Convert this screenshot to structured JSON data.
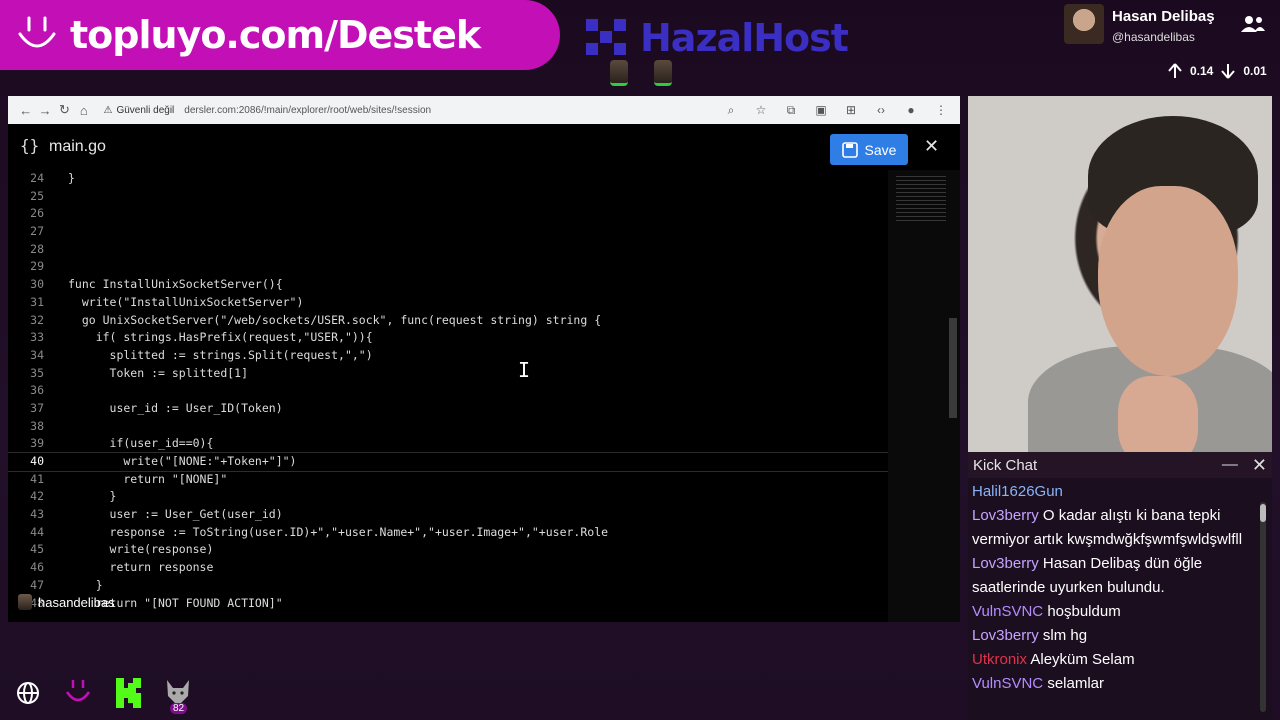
{
  "overlay": {
    "brand_text": "topluyo.com/Destek",
    "sponsor_text": "HazalHost",
    "streamer_name": "Hasan Delibaş",
    "streamer_handle": "@hasandelibas",
    "stat_up": "0.14",
    "stat_down": "0.01",
    "user_tag": "hasandelibas",
    "badge_count": "82"
  },
  "browser": {
    "security_label": "Güvenli değil",
    "url": "dersler.com:2086/!main/explorer/root/web/sites/!session"
  },
  "editor": {
    "file_name": "main.go",
    "save_label": "Save",
    "lines": [
      {
        "n": "24",
        "t": "}"
      },
      {
        "n": "25",
        "t": ""
      },
      {
        "n": "26",
        "t": ""
      },
      {
        "n": "27",
        "t": ""
      },
      {
        "n": "28",
        "t": ""
      },
      {
        "n": "29",
        "t": ""
      },
      {
        "n": "30",
        "t": "func InstallUnixSocketServer(){"
      },
      {
        "n": "31",
        "t": "  write(\"InstallUnixSocketServer\")"
      },
      {
        "n": "32",
        "t": "  go UnixSocketServer(\"/web/sockets/USER.sock\", func(request string) string {"
      },
      {
        "n": "33",
        "t": "    if( strings.HasPrefix(request,\"USER,\")){"
      },
      {
        "n": "34",
        "t": "      splitted := strings.Split(request,\",\")"
      },
      {
        "n": "35",
        "t": "      Token := splitted[1]"
      },
      {
        "n": "36",
        "t": ""
      },
      {
        "n": "37",
        "t": "      user_id := User_ID(Token)"
      },
      {
        "n": "38",
        "t": ""
      },
      {
        "n": "39",
        "t": "      if(user_id==0){"
      },
      {
        "n": "40",
        "t": "        write(\"[NONE:\"+Token+\"]\")"
      },
      {
        "n": "41",
        "t": "        return \"[NONE]\""
      },
      {
        "n": "42",
        "t": "      }"
      },
      {
        "n": "43",
        "t": "      user := User_Get(user_id)"
      },
      {
        "n": "44",
        "t": "      response := ToString(user.ID)+\",\"+user.Name+\",\"+user.Image+\",\"+user.Role"
      },
      {
        "n": "45",
        "t": "      write(response)"
      },
      {
        "n": "46",
        "t": "      return response"
      },
      {
        "n": "47",
        "t": "    }"
      },
      {
        "n": "48",
        "t": "    return \"[NOT FOUND ACTION]\""
      }
    ],
    "current_line": "40"
  },
  "chat": {
    "title": "Kick Chat",
    "messages": [
      {
        "user": "Halil1626Gun",
        "text": "",
        "color": "#8ab4f8"
      },
      {
        "user": "Lov3berry",
        "text": "O kadar alıştı ki bana tepki vermiyor artık kwşmdwğkfşwmfşwldşwlfll",
        "color": "#c6a3ff"
      },
      {
        "user": "Lov3berry",
        "text": "Hasan Delibaş dün öğle saatlerinde uyurken bulundu.",
        "color": "#c6a3ff"
      },
      {
        "user": "VulnSVNC",
        "text": "hoşbuldum",
        "color": "#b58cff"
      },
      {
        "user": "Lov3berry",
        "text": "slm hg",
        "color": "#c6a3ff"
      },
      {
        "user": "Utkronix",
        "text": "Aleyküm Selam",
        "color": "#e0334a"
      },
      {
        "user": "VulnSVNC",
        "text": "selamlar",
        "color": "#b58cff"
      }
    ]
  },
  "colors": {
    "brand": "#c20fb6",
    "save_button": "#2f7ee5",
    "background": "#1b0a1f"
  },
  "icons": {
    "globe": "globe-icon",
    "smile": "smile-logo-icon",
    "kick": "kick-logo-icon",
    "wolf": "wolf-icon"
  }
}
